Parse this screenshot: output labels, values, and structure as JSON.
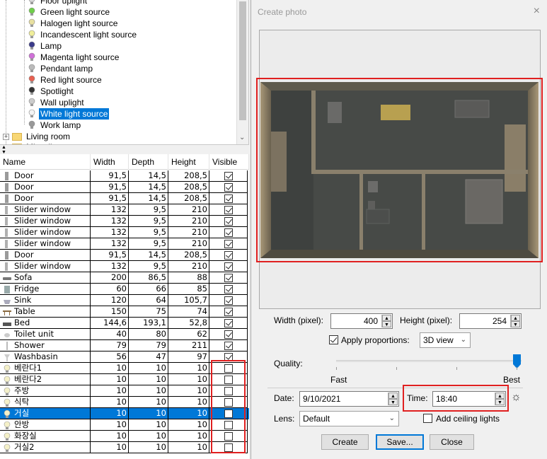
{
  "tree": {
    "items": [
      {
        "label": "Floor uplight",
        "bulb": "#d8d8d8"
      },
      {
        "label": "Green light source",
        "bulb": "#6fcf4a"
      },
      {
        "label": "Halogen light source",
        "bulb": "#e8e0a0"
      },
      {
        "label": "Incandescent light source",
        "bulb": "#f0ee9a"
      },
      {
        "label": "Lamp",
        "bulb": "#3a3a8a"
      },
      {
        "label": "Magenta light source",
        "bulb": "#d070d8"
      },
      {
        "label": "Pendant lamp",
        "bulb": "#bbbbbb"
      },
      {
        "label": "Red light source",
        "bulb": "#e86050"
      },
      {
        "label": "Spotlight",
        "bulb": "#333333"
      },
      {
        "label": "Wall uplight",
        "bulb": "#cccccc"
      },
      {
        "label": "White light source",
        "bulb": "#f4f4f4",
        "selected": true
      },
      {
        "label": "Work lamp",
        "bulb": "#999999"
      }
    ],
    "folders": [
      {
        "label": "Living room"
      },
      {
        "label": "Miscellaneous"
      }
    ]
  },
  "table": {
    "headers": {
      "name": "Name",
      "width": "Width",
      "depth": "Depth",
      "height": "Height",
      "visible": "Visible"
    },
    "rows": [
      {
        "name": "Door",
        "w": "91,5",
        "d": "14,5",
        "h": "208,5",
        "visible": true,
        "icon": "door"
      },
      {
        "name": "Door",
        "w": "91,5",
        "d": "14,5",
        "h": "208,5",
        "visible": true,
        "icon": "door"
      },
      {
        "name": "Door",
        "w": "91,5",
        "d": "14,5",
        "h": "208,5",
        "visible": true,
        "icon": "door"
      },
      {
        "name": "Slider window",
        "w": "132",
        "d": "9,5",
        "h": "210",
        "visible": true,
        "icon": "window"
      },
      {
        "name": "Slider window",
        "w": "132",
        "d": "9,5",
        "h": "210",
        "visible": true,
        "icon": "window"
      },
      {
        "name": "Slider window",
        "w": "132",
        "d": "9,5",
        "h": "210",
        "visible": true,
        "icon": "window"
      },
      {
        "name": "Slider window",
        "w": "132",
        "d": "9,5",
        "h": "210",
        "visible": true,
        "icon": "window"
      },
      {
        "name": "Door",
        "w": "91,5",
        "d": "14,5",
        "h": "208,5",
        "visible": true,
        "icon": "door"
      },
      {
        "name": "Slider window",
        "w": "132",
        "d": "9,5",
        "h": "210",
        "visible": true,
        "icon": "window"
      },
      {
        "name": "Sofa",
        "w": "200",
        "d": "86,5",
        "h": "88",
        "visible": true,
        "icon": "sofa"
      },
      {
        "name": "Fridge",
        "w": "60",
        "d": "66",
        "h": "85",
        "visible": true,
        "icon": "fridge"
      },
      {
        "name": "Sink",
        "w": "120",
        "d": "64",
        "h": "105,7",
        "visible": true,
        "icon": "sink"
      },
      {
        "name": "Table",
        "w": "150",
        "d": "75",
        "h": "74",
        "visible": true,
        "icon": "table"
      },
      {
        "name": "Bed",
        "w": "144,6",
        "d": "193,1",
        "h": "52,8",
        "visible": true,
        "icon": "bed"
      },
      {
        "name": "Toilet unit",
        "w": "40",
        "d": "80",
        "h": "62",
        "visible": true,
        "icon": "toilet"
      },
      {
        "name": "Shower",
        "w": "79",
        "d": "79",
        "h": "211",
        "visible": true,
        "icon": "shower"
      },
      {
        "name": "Washbasin",
        "w": "56",
        "d": "47",
        "h": "97",
        "visible": true,
        "icon": "washbasin"
      },
      {
        "name": "베란다1",
        "w": "10",
        "d": "10",
        "h": "10",
        "visible": false,
        "icon": "bulb"
      },
      {
        "name": "베란다2",
        "w": "10",
        "d": "10",
        "h": "10",
        "visible": false,
        "icon": "bulb"
      },
      {
        "name": "주방",
        "w": "10",
        "d": "10",
        "h": "10",
        "visible": false,
        "icon": "bulb"
      },
      {
        "name": "식탁",
        "w": "10",
        "d": "10",
        "h": "10",
        "visible": false,
        "icon": "bulb"
      },
      {
        "name": "거실",
        "w": "10",
        "d": "10",
        "h": "10",
        "visible": false,
        "icon": "bulb",
        "selected": true
      },
      {
        "name": "안방",
        "w": "10",
        "d": "10",
        "h": "10",
        "visible": false,
        "icon": "bulb"
      },
      {
        "name": "화장실",
        "w": "10",
        "d": "10",
        "h": "10",
        "visible": false,
        "icon": "bulb"
      },
      {
        "name": "거실2",
        "w": "10",
        "d": "10",
        "h": "10",
        "visible": false,
        "icon": "bulb"
      }
    ]
  },
  "dialog": {
    "title": "Create photo",
    "width_label": "Width (pixel):",
    "width_value": "400",
    "height_label": "Height (pixel):",
    "height_value": "254",
    "apply_proportions_label": "Apply proportions:",
    "apply_proportions_checked": true,
    "view_mode": "3D view",
    "quality_label": "Quality:",
    "quality_fast": "Fast",
    "quality_best": "Best",
    "quality_level": 1.0,
    "date_label": "Date:",
    "date_value": "9/10/2021",
    "time_label": "Time:",
    "time_value": "18:40",
    "lens_label": "Lens:",
    "lens_value": "Default",
    "ceiling_label": "Add ceiling lights",
    "ceiling_checked": false,
    "create_label": "Create",
    "save_label": "Save...",
    "close_label": "Close",
    "close_icon": "×"
  },
  "colors": {
    "highlight": "#e02020",
    "selection": "#0078d7"
  }
}
